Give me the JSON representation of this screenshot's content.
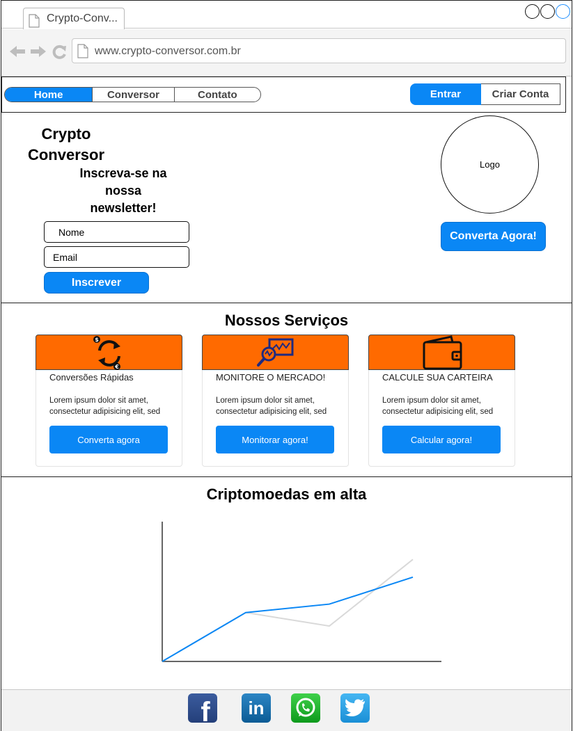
{
  "browser": {
    "tab_title": "Crypto-Conv...",
    "url": "www.crypto-conversor.com.br"
  },
  "header": {
    "nav": [
      "Home",
      "Conversor",
      "Contato"
    ],
    "login_label": "Entrar",
    "signup_label": "Criar Conta"
  },
  "hero": {
    "brand": "Crypto Conversor",
    "newsletter_heading": "Inscreva-se na nossa newsletter!",
    "name_placeholder": "Nome",
    "email_placeholder": "Email",
    "subscribe_label": "Inscrever",
    "logo_label": "Logo",
    "cta_label": "Converta Agora!"
  },
  "services": {
    "title": "Nossos Serviços",
    "cards": [
      {
        "icon": "exchange-arrows-icon",
        "title": "Conversões Rápidas",
        "text": "Lorem ipsum dolor sit amet, consectetur adipisicing elit, sed",
        "button": "Converta agora"
      },
      {
        "icon": "market-monitor-icon",
        "title": "MONITORE O MERCADO!",
        "text": "Lorem ipsum dolor sit amet, consectetur adipisicing elit, sed",
        "button": "Monitorar agora!"
      },
      {
        "icon": "wallet-icon",
        "title": "CALCULE SUA CARTEIRA",
        "text": "Lorem ipsum dolor sit amet, consectetur adipisicing elit, sed",
        "button": "Calcular agora!"
      }
    ]
  },
  "trending": {
    "title": "Criptomoedas em alta"
  },
  "chart_data": {
    "type": "line",
    "title": "Criptomoedas em alta",
    "x": [
      0,
      1,
      2,
      3
    ],
    "series": [
      {
        "values": [
          0,
          58,
          42,
          121
        ],
        "color": "#d9d9d9"
      },
      {
        "values": [
          0,
          58,
          68,
          100
        ],
        "color": "#0a87f5"
      }
    ],
    "ylim": [
      0,
      165
    ],
    "grid": false
  },
  "footer": {
    "social": [
      "facebook-icon",
      "linkedin-icon",
      "whatsapp-icon",
      "twitter-icon"
    ]
  },
  "colors": {
    "accent": "#0a87f5",
    "card_header": "#ff6a00"
  }
}
